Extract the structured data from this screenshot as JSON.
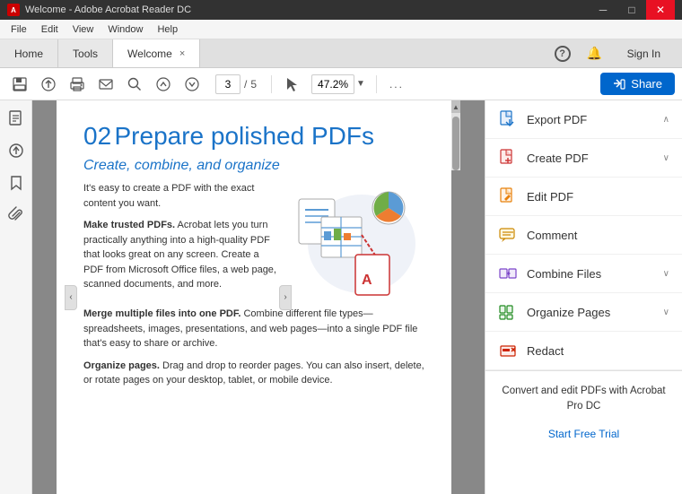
{
  "titleBar": {
    "title": "Welcome - Adobe Acrobat Reader DC",
    "minimizeLabel": "─",
    "maximizeLabel": "□",
    "closeLabel": "✕",
    "icon": "A"
  },
  "menuBar": {
    "items": [
      "File",
      "Edit",
      "View",
      "Window",
      "Help"
    ]
  },
  "tabs": {
    "home": "Home",
    "tools": "Tools",
    "welcome": "Welcome",
    "closeLabel": "×"
  },
  "navRight": {
    "helpLabel": "?",
    "notifLabel": "🔔",
    "signInLabel": "Sign In"
  },
  "toolbar": {
    "saveLabel": "💾",
    "uploadLabel": "↑",
    "printLabel": "🖨",
    "emailLabel": "✉",
    "searchLabel": "🔍",
    "upLabel": "↑",
    "downLabel": "↓",
    "pageNum": "3",
    "pageSep": "/",
    "pageTotal": "5",
    "cursorLabel": "▲",
    "zoom": "47.2%",
    "zoomDropLabel": "▼",
    "moreLabel": "...",
    "shareLabel": "Share",
    "shareIcon": "↑"
  },
  "leftSidebar": {
    "icons": [
      "📄",
      "⬆",
      "🔖",
      "📎"
    ]
  },
  "pdf": {
    "sectionNum": "02",
    "sectionTitle": " Prepare polished PDFs",
    "subtitle": "Create, combine, and organize",
    "para1": "It's easy to create a PDF with the exact content you want.",
    "bold1": "Make trusted PDFs.",
    "para2": " Acrobat lets you turn practically anything into a high-quality PDF that looks great on any screen. Create a PDF from Microsoft Office files, a web page, scanned documents, and more.",
    "bold2": "Merge multiple files into one PDF.",
    "para3": " Combine different file types—spreadsheets, images, presentations, and web pages—into a single PDF file that's easy to share or archive.",
    "bold3": "Organize pages.",
    "para4": " Drag and drop to reorder pages. You can also insert, delete, or rotate pages on your desktop, tablet, or mobile device."
  },
  "tools": {
    "items": [
      {
        "id": "export-pdf",
        "label": "Export PDF",
        "icon": "export",
        "hasChevron": true,
        "chevronDir": "up"
      },
      {
        "id": "create-pdf",
        "label": "Create PDF",
        "icon": "create",
        "hasChevron": true,
        "chevronDir": "down"
      },
      {
        "id": "edit-pdf",
        "label": "Edit PDF",
        "icon": "edit",
        "hasChevron": false
      },
      {
        "id": "comment",
        "label": "Comment",
        "icon": "comment",
        "hasChevron": false
      },
      {
        "id": "combine-files",
        "label": "Combine Files",
        "icon": "combine",
        "hasChevron": true,
        "chevronDir": "down"
      },
      {
        "id": "organize-pages",
        "label": "Organize Pages",
        "icon": "organize",
        "hasChevron": true,
        "chevronDir": "down"
      },
      {
        "id": "redact",
        "label": "Redact",
        "icon": "redact",
        "hasChevron": false
      }
    ],
    "promoText": "Convert and edit PDFs with Acrobat Pro DC",
    "startFreeLabel": "Start Free Trial"
  }
}
